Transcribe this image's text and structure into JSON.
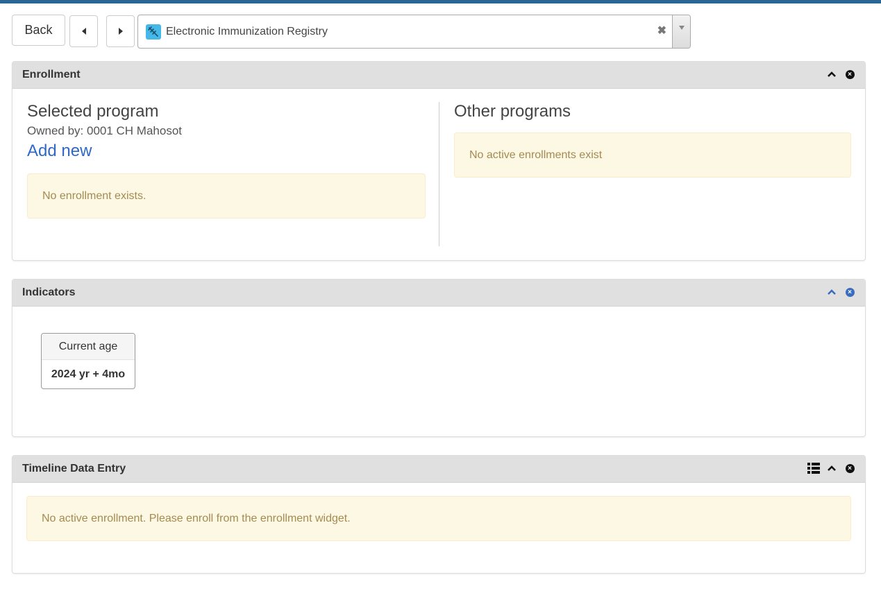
{
  "toolbar": {
    "back_label": "Back",
    "prev_icon": "caret-left-icon",
    "next_icon": "caret-right-icon"
  },
  "program_select": {
    "icon": "syringe-icon",
    "value": "Electronic Immunization Registry",
    "clear_icon": "times-icon",
    "dropdown_icon": "caret-down-icon"
  },
  "enrollment": {
    "title": "Enrollment",
    "selected_program_heading": "Selected program",
    "owned_by": "Owned by: 0001 CH Mahosot",
    "add_new": "Add new",
    "no_enrollment": "No enrollment exists.",
    "other_programs_heading": "Other programs",
    "no_active_enrollments": "No active enrollments exist"
  },
  "indicators": {
    "title": "Indicators",
    "age_label": "Current age",
    "age_value": "2024 yr + 4mo"
  },
  "timeline": {
    "title": "Timeline Data Entry",
    "message": "No active enrollment. Please enroll from the enrollment widget."
  },
  "colors": {
    "topbar": "#276696",
    "link": "#2f68c7",
    "alert_bg": "#fcf8e3",
    "alert_text": "#a38b52",
    "header_bg": "#e0e0e0",
    "program_icon_bg": "#45b8e8",
    "active_tool": "#3b6dbd"
  }
}
